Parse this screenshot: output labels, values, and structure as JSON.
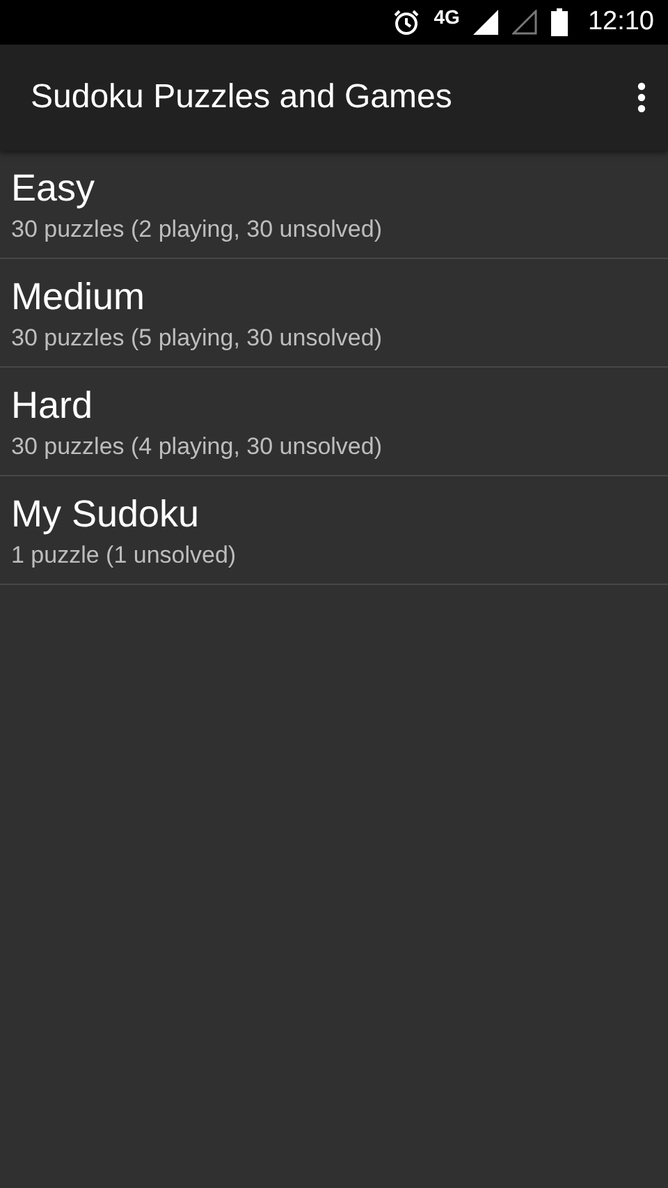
{
  "status_bar": {
    "network": "4G",
    "time": "12:10"
  },
  "app_bar": {
    "title": "Sudoku Puzzles and Games"
  },
  "folders": [
    {
      "name": "Easy",
      "detail": "30 puzzles (2 playing, 30 unsolved)"
    },
    {
      "name": "Medium",
      "detail": "30 puzzles (5 playing, 30 unsolved)"
    },
    {
      "name": "Hard",
      "detail": "30 puzzles (4 playing, 30 unsolved)"
    },
    {
      "name": "My Sudoku",
      "detail": "1 puzzle (1 unsolved)"
    }
  ]
}
